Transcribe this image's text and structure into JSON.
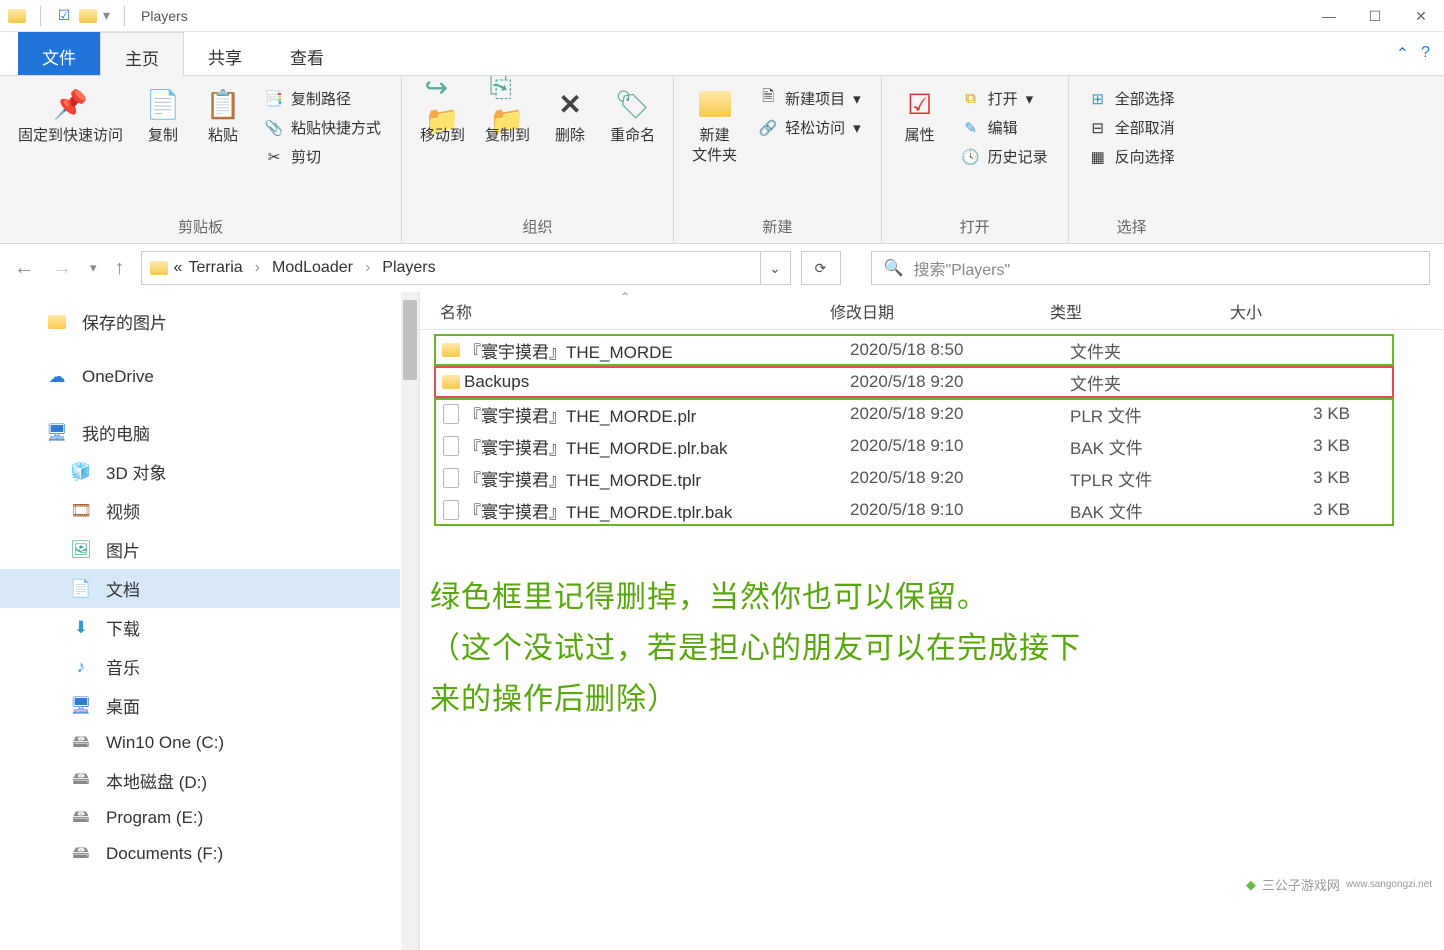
{
  "titlebar": {
    "title": "Players"
  },
  "tabs": {
    "file": "文件",
    "home": "主页",
    "share": "共享",
    "view": "查看"
  },
  "ribbon": {
    "clipboard": {
      "pin": "固定到快速访问",
      "copy": "复制",
      "paste": "粘贴",
      "copyPath": "复制路径",
      "pasteShortcut": "粘贴快捷方式",
      "cut": "剪切",
      "group": "剪贴板"
    },
    "organize": {
      "moveTo": "移动到",
      "copyTo": "复制到",
      "delete": "删除",
      "rename": "重命名",
      "group": "组织"
    },
    "new": {
      "newFolder": "新建\n文件夹",
      "newItem": "新建项目",
      "easyAccess": "轻松访问",
      "group": "新建"
    },
    "open": {
      "properties": "属性",
      "open": "打开",
      "edit": "编辑",
      "history": "历史记录",
      "group": "打开"
    },
    "select": {
      "selectAll": "全部选择",
      "selectNone": "全部取消",
      "invert": "反向选择",
      "group": "选择"
    }
  },
  "breadcrumb": {
    "p1": "Terraria",
    "p2": "ModLoader",
    "p3": "Players",
    "prefix": "«"
  },
  "search": {
    "placeholder": "搜索\"Players\""
  },
  "columns": {
    "name": "名称",
    "date": "修改日期",
    "type": "类型",
    "size": "大小"
  },
  "sidebar": [
    {
      "icon": "folder",
      "label": "保存的图片",
      "lvl": 1
    },
    {
      "icon": "cloud",
      "label": "OneDrive",
      "lvl": 1
    },
    {
      "icon": "pc",
      "label": "我的电脑",
      "lvl": 1
    },
    {
      "icon": "cube",
      "label": "3D 对象",
      "lvl": 2
    },
    {
      "icon": "video",
      "label": "视频",
      "lvl": 2
    },
    {
      "icon": "pic",
      "label": "图片",
      "lvl": 2
    },
    {
      "icon": "doc",
      "label": "文档",
      "lvl": 2,
      "sel": true
    },
    {
      "icon": "dl",
      "label": "下载",
      "lvl": 2
    },
    {
      "icon": "music",
      "label": "音乐",
      "lvl": 2
    },
    {
      "icon": "desk",
      "label": "桌面",
      "lvl": 2
    },
    {
      "icon": "drive",
      "label": "Win10 One (C:)",
      "lvl": 2
    },
    {
      "icon": "drive",
      "label": "本地磁盘 (D:)",
      "lvl": 2
    },
    {
      "icon": "drive",
      "label": "Program (E:)",
      "lvl": 2
    },
    {
      "icon": "drive",
      "label": "Documents (F:)",
      "lvl": 2
    }
  ],
  "files": [
    {
      "icon": "folder",
      "name": "『寰宇摸君』THE_MORDE",
      "date": "2020/5/18 8:50",
      "type": "文件夹",
      "size": ""
    },
    {
      "icon": "folder",
      "name": "Backups",
      "date": "2020/5/18 9:20",
      "type": "文件夹",
      "size": ""
    },
    {
      "icon": "file",
      "name": "『寰宇摸君』THE_MORDE.plr",
      "date": "2020/5/18 9:20",
      "type": "PLR 文件",
      "size": "3 KB"
    },
    {
      "icon": "file",
      "name": "『寰宇摸君』THE_MORDE.plr.bak",
      "date": "2020/5/18 9:10",
      "type": "BAK 文件",
      "size": "3 KB"
    },
    {
      "icon": "file",
      "name": "『寰宇摸君』THE_MORDE.tplr",
      "date": "2020/5/18 9:20",
      "type": "TPLR 文件",
      "size": "3 KB"
    },
    {
      "icon": "file",
      "name": "『寰宇摸君』THE_MORDE.tplr.bak",
      "date": "2020/5/18 9:10",
      "type": "BAK 文件",
      "size": "3 KB"
    }
  ],
  "annotation": {
    "l1": "绿色框里记得删掉，当然你也可以保留。",
    "l2": "（这个没试过，若是担心的朋友可以在完成接下",
    "l3": "来的操作后删除）"
  },
  "watermark": {
    "text": "三公子游戏网",
    "url": "www.sangongzi.net"
  }
}
